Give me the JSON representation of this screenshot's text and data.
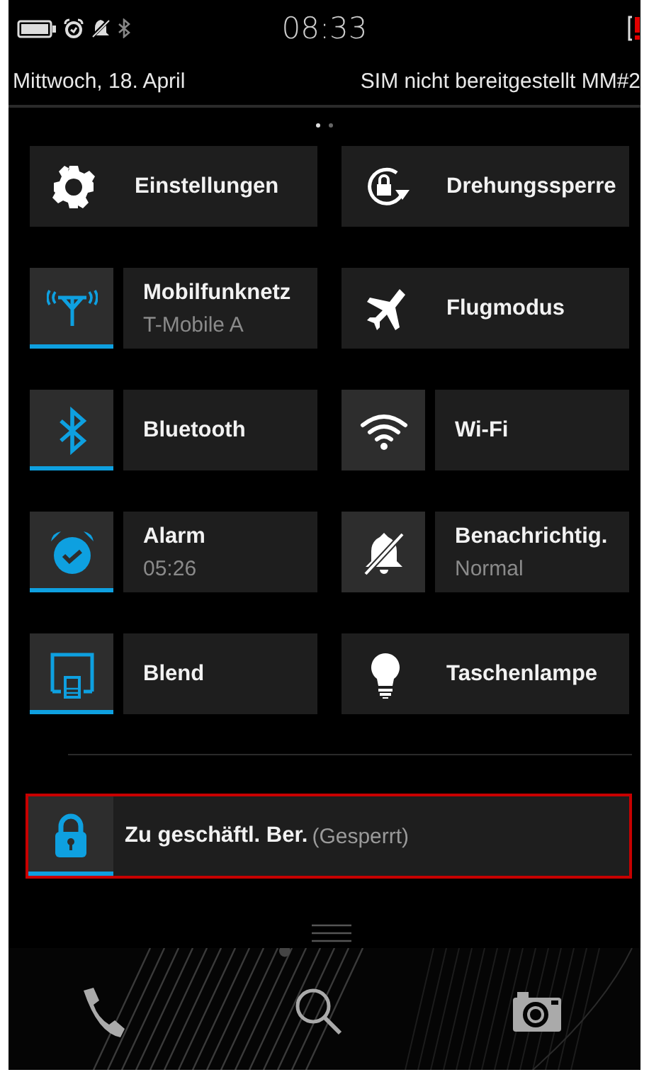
{
  "status_bar": {
    "time": "08:33"
  },
  "header": {
    "date": "Mittwoch, 18. April",
    "carrier": "SIM nicht bereitgestellt MM#2",
    "pages": [
      {
        "selected": true
      },
      {
        "selected": false
      }
    ]
  },
  "tiles": [
    {
      "kind": "action",
      "label": "Einstellungen"
    },
    {
      "kind": "action",
      "label": "Drehungssperre"
    },
    {
      "kind": "toggle",
      "label": "Mobilfunknetz",
      "detail": "T-Mobile A",
      "on": true
    },
    {
      "kind": "action",
      "label": "Flugmodus"
    },
    {
      "kind": "toggle",
      "label": "Bluetooth",
      "on": true
    },
    {
      "kind": "toggle",
      "label": "Wi-Fi",
      "on": false
    },
    {
      "kind": "toggle",
      "label": "Alarm",
      "detail": "05:26",
      "on": true
    },
    {
      "kind": "toggle",
      "label": "Benachrichtig.",
      "detail": "Normal",
      "on": false
    },
    {
      "kind": "toggle",
      "label": "Blend",
      "on": true
    },
    {
      "kind": "action",
      "label": "Taschenlampe"
    }
  ],
  "work_space": {
    "label": "Zu geschäftl. Ber.",
    "status": "(Gesperrt)",
    "on": true,
    "highlighted": true
  }
}
